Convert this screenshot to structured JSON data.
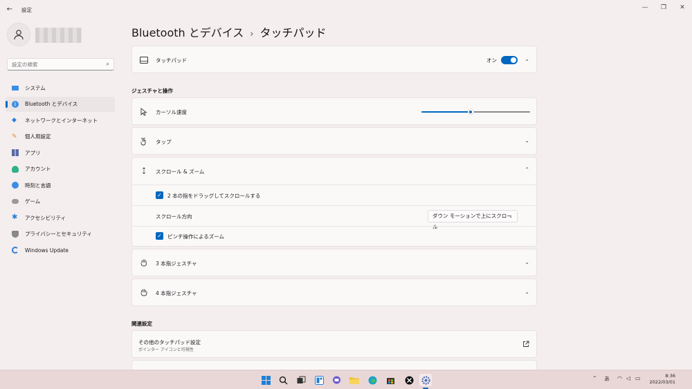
{
  "window": {
    "back_glyph": "←",
    "title": "設定",
    "controls": {
      "minimize": "—",
      "maximize": "❐",
      "close": "✕"
    }
  },
  "sidebar": {
    "search_placeholder": "設定の検索",
    "items": [
      {
        "label": "システム",
        "icon": "monitor-icon",
        "color": "#3a8ee6"
      },
      {
        "label": "Bluetooth とデバイス",
        "icon": "bluetooth-icon",
        "color": "#3a8ee6",
        "active": true
      },
      {
        "label": "ネットワークとインターネット",
        "icon": "wifi-icon",
        "color": "#2a7fd4"
      },
      {
        "label": "個人用設定",
        "icon": "brush-icon",
        "color": "#e08a3a"
      },
      {
        "label": "アプリ",
        "icon": "apps-icon",
        "color": "#5a6aa8"
      },
      {
        "label": "アカウント",
        "icon": "person-icon",
        "color": "#2fb08a"
      },
      {
        "label": "時刻と言語",
        "icon": "globe-clock-icon",
        "color": "#3a8ee6"
      },
      {
        "label": "ゲーム",
        "icon": "gamepad-icon",
        "color": "#888888"
      },
      {
        "label": "アクセシビリティ",
        "icon": "accessibility-icon",
        "color": "#2a7fd4"
      },
      {
        "label": "プライバシーとセキュリティ",
        "icon": "shield-icon",
        "color": "#777777"
      },
      {
        "label": "Windows Update",
        "icon": "update-icon",
        "color": "#2a7fd4"
      }
    ]
  },
  "header": {
    "parent": "Bluetooth とデバイス",
    "separator": "›",
    "current": "タッチパッド"
  },
  "touchpad": {
    "label": "タッチパッド",
    "state_label": "オン",
    "enabled": true
  },
  "gestures": {
    "section_title": "ジェスチャと操作",
    "cursor_speed": {
      "label": "カーソル速度",
      "value_fraction": 0.45
    },
    "tap": {
      "label": "タップ"
    },
    "scroll_zoom": {
      "label": "スクロール & ズーム",
      "two_finger_drag": {
        "label": "2 本の指をドラッグしてスクロールする",
        "checked": true
      },
      "scroll_direction": {
        "label": "スクロール方向",
        "value": "ダウン モーションで上にスクロール"
      },
      "pinch_zoom": {
        "label": "ピンチ操作によるズーム",
        "checked": true
      }
    },
    "three_finger": {
      "label": "3 本指ジェスチャ"
    },
    "four_finger": {
      "label": "4 本指ジェスチャ"
    }
  },
  "related": {
    "section_title": "関連設定",
    "more_touchpad": {
      "label": "その他のタッチパッド設定",
      "sublabel": "ポインター アイコンと可視性"
    }
  },
  "taskbar": {
    "tray_ime": "あ",
    "time": "8:36",
    "date": "2022/03/01",
    "accent": "#0067c0"
  }
}
